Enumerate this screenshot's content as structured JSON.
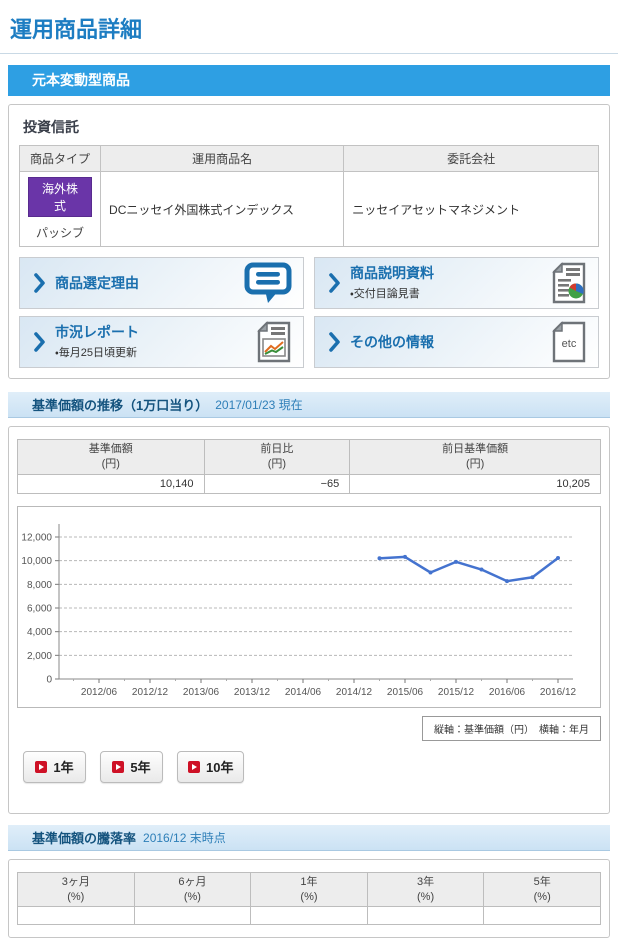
{
  "page": {
    "title": "運用商品詳細"
  },
  "banner": {
    "label": "元本変動型商品",
    "color": "#2e9fe3"
  },
  "fund_section": {
    "heading": "投資信託",
    "table": {
      "headers": [
        "商品タイプ",
        "運用商品名",
        "委託会社"
      ],
      "row": {
        "type_badge": "海外株式",
        "type_sub": "パッシブ",
        "product_name": "DCニッセイ外国株式インデックス",
        "trustee": "ニッセイアセットマネジメント"
      }
    },
    "links": [
      {
        "label": "商品選定理由",
        "sub": "",
        "icon": "speech-bubble"
      },
      {
        "label": "商品説明資料",
        "sub": "・交付目論見書",
        "icon": "document-pie"
      },
      {
        "label": "市況レポート",
        "sub": "・毎月25日頃更新",
        "icon": "document-chart"
      },
      {
        "label": "その他の情報",
        "sub": "",
        "icon": "document-etc"
      }
    ]
  },
  "nav_section": {
    "heading": "基準価額の推移（1万口当り）",
    "as_of": "2017/01/23 現在",
    "table": {
      "cols": [
        {
          "name": "基準価額",
          "unit": "(円)",
          "value": "10,140"
        },
        {
          "name": "前日比",
          "unit": "(円)",
          "value": "−65"
        },
        {
          "name": "前日基準価額",
          "unit": "(円)",
          "value": "10,205"
        }
      ]
    },
    "axis_note": "縦軸：基準価額（円）　横軸：年月",
    "period_buttons": [
      "1年",
      "5年",
      "10年"
    ]
  },
  "chart_data": {
    "type": "line",
    "title": "基準価額の推移（1万口当り）",
    "ylabel": "基準価額（円）",
    "xlabel": "年月",
    "ylim": [
      0,
      12000
    ],
    "y_ticks": [
      0,
      2000,
      4000,
      6000,
      8000,
      10000,
      12000
    ],
    "y_tick_labels": [
      "0",
      "2,000",
      "4,000",
      "6,000",
      "8,000",
      "10,000",
      "12,000"
    ],
    "x_ticks": [
      "2012/06",
      "2012/12",
      "2013/06",
      "2013/12",
      "2014/06",
      "2014/12",
      "2015/06",
      "2015/12",
      "2016/06",
      "2016/12"
    ],
    "grid": "horizontal-dashed",
    "legend": "none",
    "line_color": "#4473cf",
    "series": [
      {
        "name": "基準価額",
        "color": "#4473cf",
        "points": [
          {
            "x": "2015/03",
            "y": 10200
          },
          {
            "x": "2015/06",
            "y": 10320
          },
          {
            "x": "2015/09",
            "y": 9000
          },
          {
            "x": "2015/12",
            "y": 9900
          },
          {
            "x": "2016/03",
            "y": 9250
          },
          {
            "x": "2016/06",
            "y": 8270
          },
          {
            "x": "2016/09",
            "y": 8600
          },
          {
            "x": "2016/12",
            "y": 10230
          }
        ]
      }
    ]
  },
  "change_section": {
    "heading": "基準価額の騰落率",
    "as_of": "2016/12 末時点",
    "table": {
      "cols": [
        {
          "name": "3ヶ月",
          "unit": "(%)"
        },
        {
          "name": "6ヶ月",
          "unit": "(%)"
        },
        {
          "name": "1年",
          "unit": "(%)"
        },
        {
          "name": "3年",
          "unit": "(%)"
        },
        {
          "name": "5年",
          "unit": "(%)"
        }
      ]
    }
  }
}
